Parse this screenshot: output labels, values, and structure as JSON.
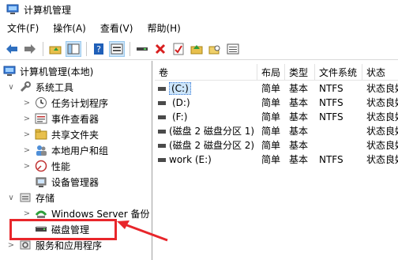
{
  "window": {
    "title": "计算机管理"
  },
  "menu": [
    "文件(F)",
    "操作(A)",
    "查看(V)",
    "帮助(H)"
  ],
  "toolbar_icons": [
    "back-arrow-icon",
    "forward-arrow-icon",
    "folder-up-icon",
    "show-tree-icon",
    "help-icon",
    "console-icon",
    "connect-icon",
    "delete-icon",
    "properties-icon",
    "folder-arrow-icon",
    "folder-search-icon",
    "list-view-icon"
  ],
  "tree": {
    "root": "计算机管理(本地)",
    "system_tools": "系统工具",
    "task_scheduler": "任务计划程序",
    "event_viewer": "事件查看器",
    "shared_folders": "共享文件夹",
    "local_users": "本地用户和组",
    "performance": "性能",
    "device_manager": "设备管理器",
    "storage": "存储",
    "windows_backup": "Windows Server 备份",
    "disk_management": "磁盘管理",
    "services_apps": "服务和应用程序"
  },
  "table": {
    "headers": [
      "卷",
      "布局",
      "类型",
      "文件系统",
      "状态"
    ],
    "rows": [
      {
        "volume": "(C:)",
        "layout": "简单",
        "type": "基本",
        "fs": "NTFS",
        "status": "状态良好"
      },
      {
        "volume": "(D:)",
        "layout": "简单",
        "type": "基本",
        "fs": "NTFS",
        "status": "状态良好"
      },
      {
        "volume": "(F:)",
        "layout": "简单",
        "type": "基本",
        "fs": "NTFS",
        "status": "状态良好"
      },
      {
        "volume": "(磁盘 2 磁盘分区 1)",
        "layout": "简单",
        "type": "基本",
        "fs": "",
        "status": "状态良好"
      },
      {
        "volume": "(磁盘 2 磁盘分区 2)",
        "layout": "简单",
        "type": "基本",
        "fs": "",
        "status": "状态良好"
      },
      {
        "volume": "work (E:)",
        "layout": "简单",
        "type": "基本",
        "fs": "NTFS",
        "status": "状态良好"
      }
    ]
  },
  "colors": {
    "highlight": "#e8262b",
    "selection": "#cde6fb"
  }
}
